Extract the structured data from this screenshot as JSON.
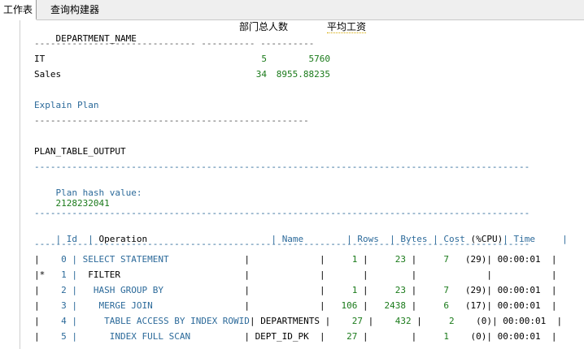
{
  "tabs": [
    "工作表",
    "查询构建器"
  ],
  "result": {
    "col_department": "DEPARTMENT_NAME",
    "col_headcount": "部门总人数",
    "col_avg_salary": "平均工资",
    "separator": "------------------------------ ---------- ----------",
    "rows": [
      {
        "name": "IT",
        "count": "5",
        "avg": "5760"
      },
      {
        "name": "Sales",
        "count": "34",
        "avg": "8955.88235"
      }
    ]
  },
  "explain": {
    "title": "Explain Plan",
    "separator": "---------------------------------------------------",
    "output_header": "PLAN_TABLE_OUTPUT",
    "long_separator": "--------------------------------------------------------------------------------------------",
    "hash_label": "Plan hash value:",
    "hash_value": "2128232041"
  },
  "plan": {
    "columns": {
      "id": "Id",
      "operation": "Operation",
      "name": "Name",
      "rows": "Rows",
      "bytes": "Bytes",
      "cost": "Cost",
      "cpu": "(%CPU)",
      "time": "Time"
    },
    "steps": [
      {
        "prefix": "|",
        "id": "0",
        "operation": "SELECT STATEMENT",
        "name": "",
        "rows": "1",
        "bytes": "23",
        "cost": "7",
        "cpu": "(29)",
        "time": "00:00:01"
      },
      {
        "prefix": "|*",
        "id": "1",
        "operation": " FILTER",
        "name": "",
        "rows": "",
        "bytes": "",
        "cost": "",
        "cpu": "",
        "time": ""
      },
      {
        "prefix": "|",
        "id": "2",
        "operation": "  HASH GROUP BY",
        "name": "",
        "rows": "1",
        "bytes": "23",
        "cost": "7",
        "cpu": "(29)",
        "time": "00:00:01"
      },
      {
        "prefix": "|",
        "id": "3",
        "operation": "   MERGE JOIN",
        "name": "",
        "rows": "106",
        "bytes": "2438",
        "cost": "6",
        "cpu": "(17)",
        "time": "00:00:01"
      },
      {
        "prefix": "|",
        "id": "4",
        "operation": "    TABLE ACCESS BY INDEX ROWID",
        "name": "DEPARTMENTS",
        "rows": "27",
        "bytes": "432",
        "cost": "2",
        "cpu": "(0)",
        "time": "00:00:01"
      },
      {
        "prefix": "|",
        "id": "5",
        "operation": "     INDEX FULL SCAN",
        "name": "DEPT_ID_PK",
        "rows": "27",
        "bytes": "",
        "cost": "1",
        "cpu": "(0)",
        "time": "00:00:01"
      }
    ]
  }
}
